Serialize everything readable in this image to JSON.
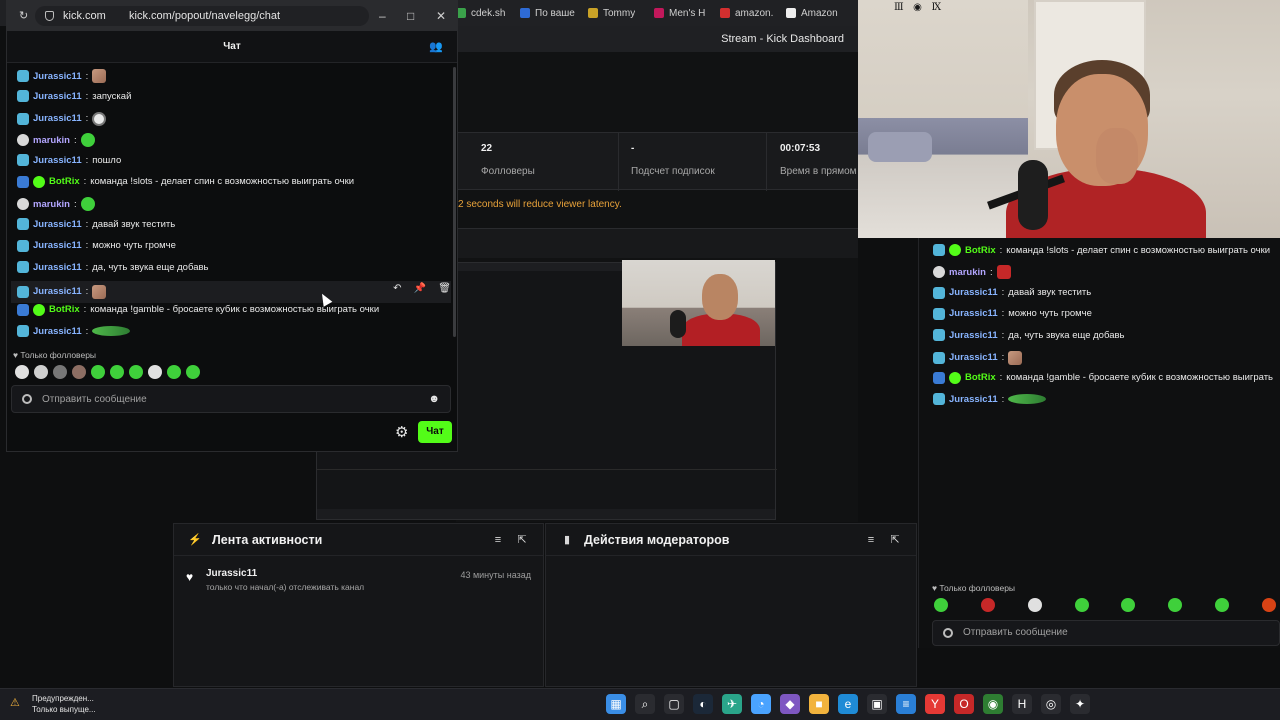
{
  "background": {
    "tabs": [
      {
        "label": "cdek.sh",
        "color": "#3aa14a"
      },
      {
        "label": "По ваше",
        "color": "#2e6bd6"
      },
      {
        "label": "Tommy",
        "color": "#c9a227"
      },
      {
        "label": "Men's H",
        "color": "#c2185b"
      },
      {
        "label": "amazon.",
        "color": "#d32f2f"
      },
      {
        "label": "Amazon",
        "color": "#eeeeee"
      }
    ],
    "window_title": "Stream - Kick Dashboard",
    "stats": [
      {
        "value": "22",
        "label": "Фолловеры"
      },
      {
        "value": "-",
        "label": "Подсчет подписок"
      },
      {
        "value": "00:07:53",
        "label": "Время в прямом"
      }
    ],
    "latency_note": "2 seconds will reduce viewer latency.",
    "activity_panel": {
      "title": "Лента активности",
      "item": {
        "name": "Jurassic11",
        "time": "43 минуты назад",
        "desc": "только что начал(-а) отслеживать канал"
      }
    },
    "mod_panel": {
      "title": "Действия модераторов"
    }
  },
  "popout": {
    "tab_label": "kick.com",
    "url_domain": "kick.com",
    "url_path": "kick.com/popout/navelegg/chat",
    "header_title": "Чат",
    "messages": [
      {
        "badges": [
          "sub"
        ],
        "user": "Jurassic11",
        "type": "j",
        "text": "",
        "emote": "hand"
      },
      {
        "badges": [
          "sub"
        ],
        "user": "Jurassic11",
        "type": "j",
        "text": "запускай",
        "emote": ""
      },
      {
        "badges": [
          "sub"
        ],
        "user": "Jurassic11",
        "type": "j",
        "text": "",
        "emote": "face"
      },
      {
        "badges": [
          "dim"
        ],
        "user": "marukin",
        "type": "m",
        "text": "",
        "emote": "grn"
      },
      {
        "badges": [
          "sub"
        ],
        "user": "Jurassic11",
        "type": "j",
        "text": "пошло",
        "emote": ""
      },
      {
        "badges": [
          "bot",
          "ver"
        ],
        "user": "BotRix",
        "type": "b",
        "text": "команда !slots - делает спин с возможностью выиграть очки",
        "emote": ""
      },
      {
        "badges": [
          "dim"
        ],
        "user": "marukin",
        "type": "m",
        "text": "",
        "emote": "grn"
      },
      {
        "badges": [
          "sub"
        ],
        "user": "Jurassic11",
        "type": "j",
        "text": "давай звук тестить",
        "emote": ""
      },
      {
        "badges": [
          "sub"
        ],
        "user": "Jurassic11",
        "type": "j",
        "text": "можно чуть громче",
        "emote": ""
      },
      {
        "badges": [
          "sub"
        ],
        "user": "Jurassic11",
        "type": "j",
        "text": "да, чуть звука еще добавь",
        "emote": ""
      },
      {
        "badges": [
          "sub"
        ],
        "user": "Jurassic11",
        "type": "j",
        "text": "",
        "emote": "hand"
      },
      {
        "badges": [
          "bot",
          "ver"
        ],
        "user": "BotRix",
        "type": "b",
        "text": "команда !gamble - бросаете кубик с возможностью выиграть очки",
        "emote": ""
      },
      {
        "badges": [
          "sub"
        ],
        "user": "Jurassic11",
        "type": "j",
        "text": "",
        "emote": "pepe"
      }
    ],
    "followers_only": "Только фолловеры",
    "input_placeholder": "Отправить сообщение",
    "send_label": "Чат"
  },
  "right_chat": {
    "messages": [
      {
        "badges": [
          "sub",
          "ver"
        ],
        "user": "BotRix",
        "type": "b",
        "text": "команда !slots - делает спин с возможностью выиграть очки",
        "emote": ""
      },
      {
        "badges": [
          "dim"
        ],
        "user": "marukin",
        "type": "m",
        "text": "",
        "emote": "red"
      },
      {
        "badges": [
          "sub"
        ],
        "user": "Jurassic11",
        "type": "j",
        "text": "давай звук тестить",
        "emote": ""
      },
      {
        "badges": [
          "sub"
        ],
        "user": "Jurassic11",
        "type": "j",
        "text": "можно чуть громче",
        "emote": ""
      },
      {
        "badges": [
          "sub"
        ],
        "user": "Jurassic11",
        "type": "j",
        "text": "да, чуть звука еще добавь",
        "emote": ""
      },
      {
        "badges": [
          "sub"
        ],
        "user": "Jurassic11",
        "type": "j",
        "text": "",
        "emote": "hand"
      },
      {
        "badges": [
          "bot",
          "ver"
        ],
        "user": "BotRix",
        "type": "b",
        "text": "команда !gamble - бросаете кубик с возможностью выиграть",
        "emote": ""
      },
      {
        "badges": [
          "sub"
        ],
        "user": "Jurassic11",
        "type": "j",
        "text": "",
        "emote": "pepe"
      }
    ],
    "followers_only": "Только фолловеры",
    "input_placeholder": "Отправить сообщение"
  },
  "taskbar": {
    "warning_line1": "Предупрежден...",
    "warning_line2": "Только выпуще...",
    "icons": [
      {
        "name": "windows-start-icon",
        "glyph": "▦",
        "color": "#3a8ee6"
      },
      {
        "name": "search-icon",
        "glyph": "⌕",
        "color": "#2a2b30"
      },
      {
        "name": "task-view-icon",
        "glyph": "▢",
        "color": "#2a2b30"
      },
      {
        "name": "steam-icon",
        "glyph": "◐",
        "color": "#1b2838"
      },
      {
        "name": "vpn-icon",
        "glyph": "✈",
        "color": "#2aa58a"
      },
      {
        "name": "chat-icon",
        "glyph": "◔",
        "color": "#4aa3ff"
      },
      {
        "name": "apps-icon",
        "glyph": "◆",
        "color": "#7e57c2"
      },
      {
        "name": "folder-icon",
        "glyph": "■",
        "color": "#f2b33d"
      },
      {
        "name": "edge-icon",
        "glyph": "e",
        "color": "#1f8bd6"
      },
      {
        "name": "store-icon",
        "glyph": "▣",
        "color": "#2a2b30"
      },
      {
        "name": "layers-icon",
        "glyph": "≡",
        "color": "#2a7fd6"
      },
      {
        "name": "yandex-icon",
        "glyph": "Y",
        "color": "#e53935"
      },
      {
        "name": "opera-icon",
        "glyph": "O",
        "color": "#c62828"
      },
      {
        "name": "chrome-icon",
        "glyph": "◉",
        "color": "#2e7d32"
      },
      {
        "name": "app-h-icon",
        "glyph": "H",
        "color": "#2a2b30"
      },
      {
        "name": "github-icon",
        "glyph": "◎",
        "color": "#2a2b30"
      },
      {
        "name": "star-icon",
        "glyph": "✦",
        "color": "#2a2b30"
      }
    ]
  }
}
